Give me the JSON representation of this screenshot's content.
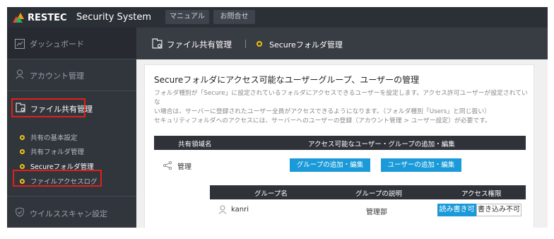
{
  "brand": {
    "logo_text": "RESTEC",
    "app_title": "Security System"
  },
  "top_buttons": [
    {
      "label": "マニュアル"
    },
    {
      "label": "お問合せ"
    }
  ],
  "sidebar": {
    "dashboard": "ダッシュボード",
    "account": "アカウント管理",
    "file_share": "ファイル共有管理",
    "sub_items": [
      {
        "label": "共有の基本設定"
      },
      {
        "label": "共有フォルダ管理"
      },
      {
        "label": "Secureフォルダ管理"
      },
      {
        "label": "ファイルアクセスログ"
      }
    ],
    "virus": "ウイルススキャン設定"
  },
  "breadcrumb": {
    "section": "ファイル共有管理",
    "page": "Secureフォルダ管理"
  },
  "panel": {
    "title": "Secureフォルダにアクセス可能なユーザーグループ、ユーザーの管理",
    "desc_lines": [
      "フォルダ種別が「Secure」に設定されているフォルダにアクセスできるユーザーを設定します。アクセス許可ユーザーが設定されていな",
      "い場合は、サーバーに登録されたユーザー全員がアクセスできるようになります。（フォルダ種別「Users」と同じ扱い）",
      "セキュリティフォルダへのアクセスには、サーバーへのユーザーの登録（アカウント管理 > ユーザー設定）が必要です。"
    ]
  },
  "share_table": {
    "headers": [
      "共有領域名",
      "アクセス可能なユーザー・グループの追加・編集"
    ],
    "row": {
      "name": "管理",
      "add_group": "グループの追加・編集",
      "add_user": "ユーザーの追加・編集"
    }
  },
  "group_table": {
    "headers": [
      "グループ名",
      "グループの説明",
      "アクセス権限"
    ],
    "row": {
      "name": "kanri",
      "desc": "管理部",
      "perm_rw": "読み書き可",
      "perm_no": "書き込み不可"
    }
  },
  "colors": {
    "accent": "#1a9ad8",
    "highlight": "#e0201a",
    "dot": "#f1c40f",
    "topbar": "#2b2f36"
  }
}
